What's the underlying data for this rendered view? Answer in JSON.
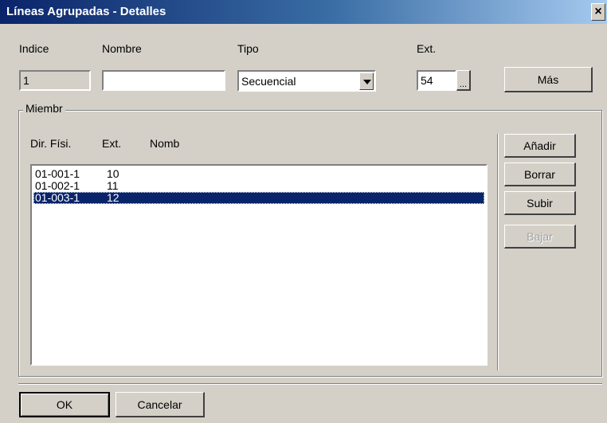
{
  "window": {
    "title": "Líneas Agrupadas - Detalles",
    "close_label": "×"
  },
  "header": {
    "indice_label": "Indice",
    "nombre_label": "Nombre",
    "tipo_label": "Tipo",
    "ext_label": "Ext.",
    "indice_value": "1",
    "nombre_value": "",
    "tipo_value": "Secuencial",
    "ext_value": "54",
    "ext_browse_label": "...",
    "mas_label": "Más"
  },
  "members": {
    "group_label": "Miembr",
    "col_dir": "Dir. Físi.",
    "col_ext": "Ext.",
    "col_nomb": "Nomb",
    "rows": [
      {
        "dir": "01-001-1",
        "ext": "10",
        "nomb": ""
      },
      {
        "dir": "01-002-1",
        "ext": "11",
        "nomb": ""
      },
      {
        "dir": "01-003-1",
        "ext": "12",
        "nomb": ""
      }
    ],
    "selected_index": 2,
    "buttons": {
      "add": "Añadir",
      "delete": "Borrar",
      "up": "Subir",
      "down": "Bajar"
    }
  },
  "footer": {
    "ok": "OK",
    "cancel": "Cancelar"
  }
}
